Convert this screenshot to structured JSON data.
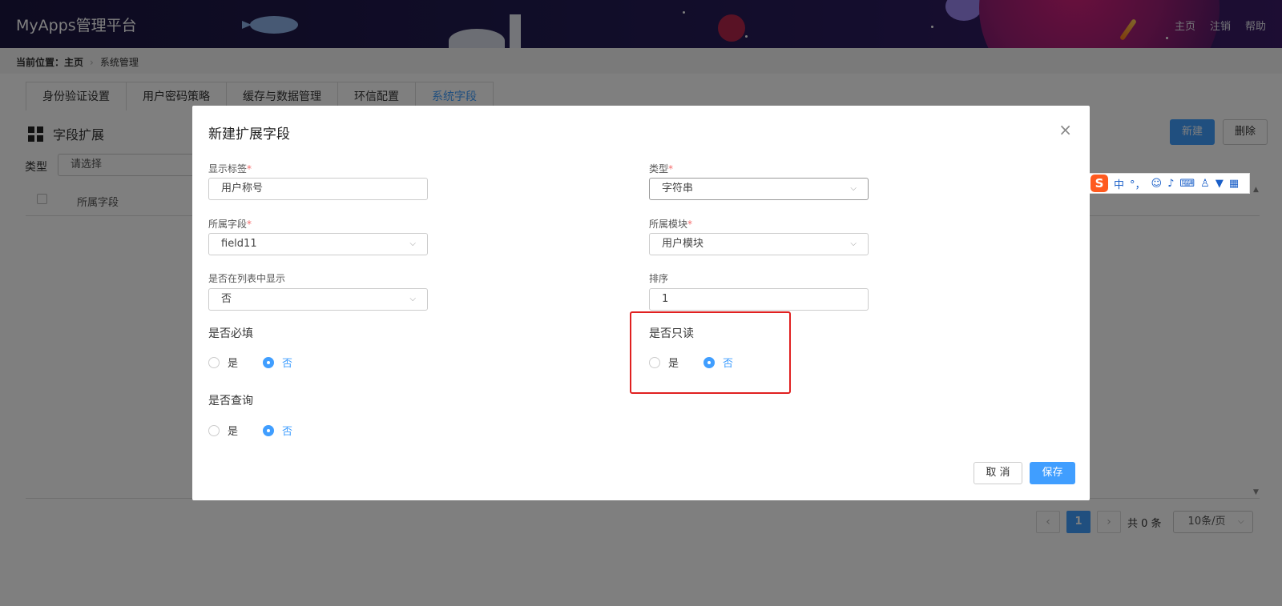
{
  "header": {
    "app_title": "MyApps管理平台",
    "nav": {
      "home": "主页",
      "logout": "注销",
      "help": "帮助"
    }
  },
  "breadcrumb": {
    "prefix": "当前位置：主页",
    "current": "系统管理"
  },
  "tabs": [
    {
      "label": "身份验证设置",
      "active": false
    },
    {
      "label": "用户密码策略",
      "active": false
    },
    {
      "label": "缓存与数据管理",
      "active": false
    },
    {
      "label": "环信配置",
      "active": false
    },
    {
      "label": "系统字段",
      "active": true
    }
  ],
  "section": {
    "title": "字段扩展"
  },
  "toolbar": {
    "new_label": "新建",
    "delete_label": "删除"
  },
  "filter": {
    "type_label": "类型",
    "type_placeholder": "请选择"
  },
  "table": {
    "columns": [
      "所属字段"
    ]
  },
  "pagination": {
    "current_page": "1",
    "total_text": "共 0 条",
    "page_size": "10条/页"
  },
  "ime": {
    "mode": "中",
    "punct": "°，"
  },
  "modal": {
    "title": "新建扩展字段",
    "fields": {
      "label": {
        "label": "显示标签",
        "value": "用户称号"
      },
      "type": {
        "label": "类型",
        "value": "字符串"
      },
      "field": {
        "label": "所属字段",
        "value": "field11"
      },
      "module": {
        "label": "所属模块",
        "value": "用户模块"
      },
      "show_in_list": {
        "label": "是否在列表中显示",
        "value": "否"
      },
      "order": {
        "label": "排序",
        "value": "1"
      }
    },
    "required_group": {
      "label": "是否必填",
      "yes": "是",
      "no": "否",
      "selected": "否"
    },
    "readonly_group": {
      "label": "是否只读",
      "yes": "是",
      "no": "否",
      "selected": "否"
    },
    "query_group": {
      "label": "是否查询",
      "yes": "是",
      "no": "否",
      "selected": "否"
    },
    "cancel_label": "取 消",
    "save_label": "保存"
  },
  "colors": {
    "primary": "#409eff",
    "required_mark": "#f56c6c",
    "highlight": "#e02020",
    "header_bg": "#1b1640"
  }
}
